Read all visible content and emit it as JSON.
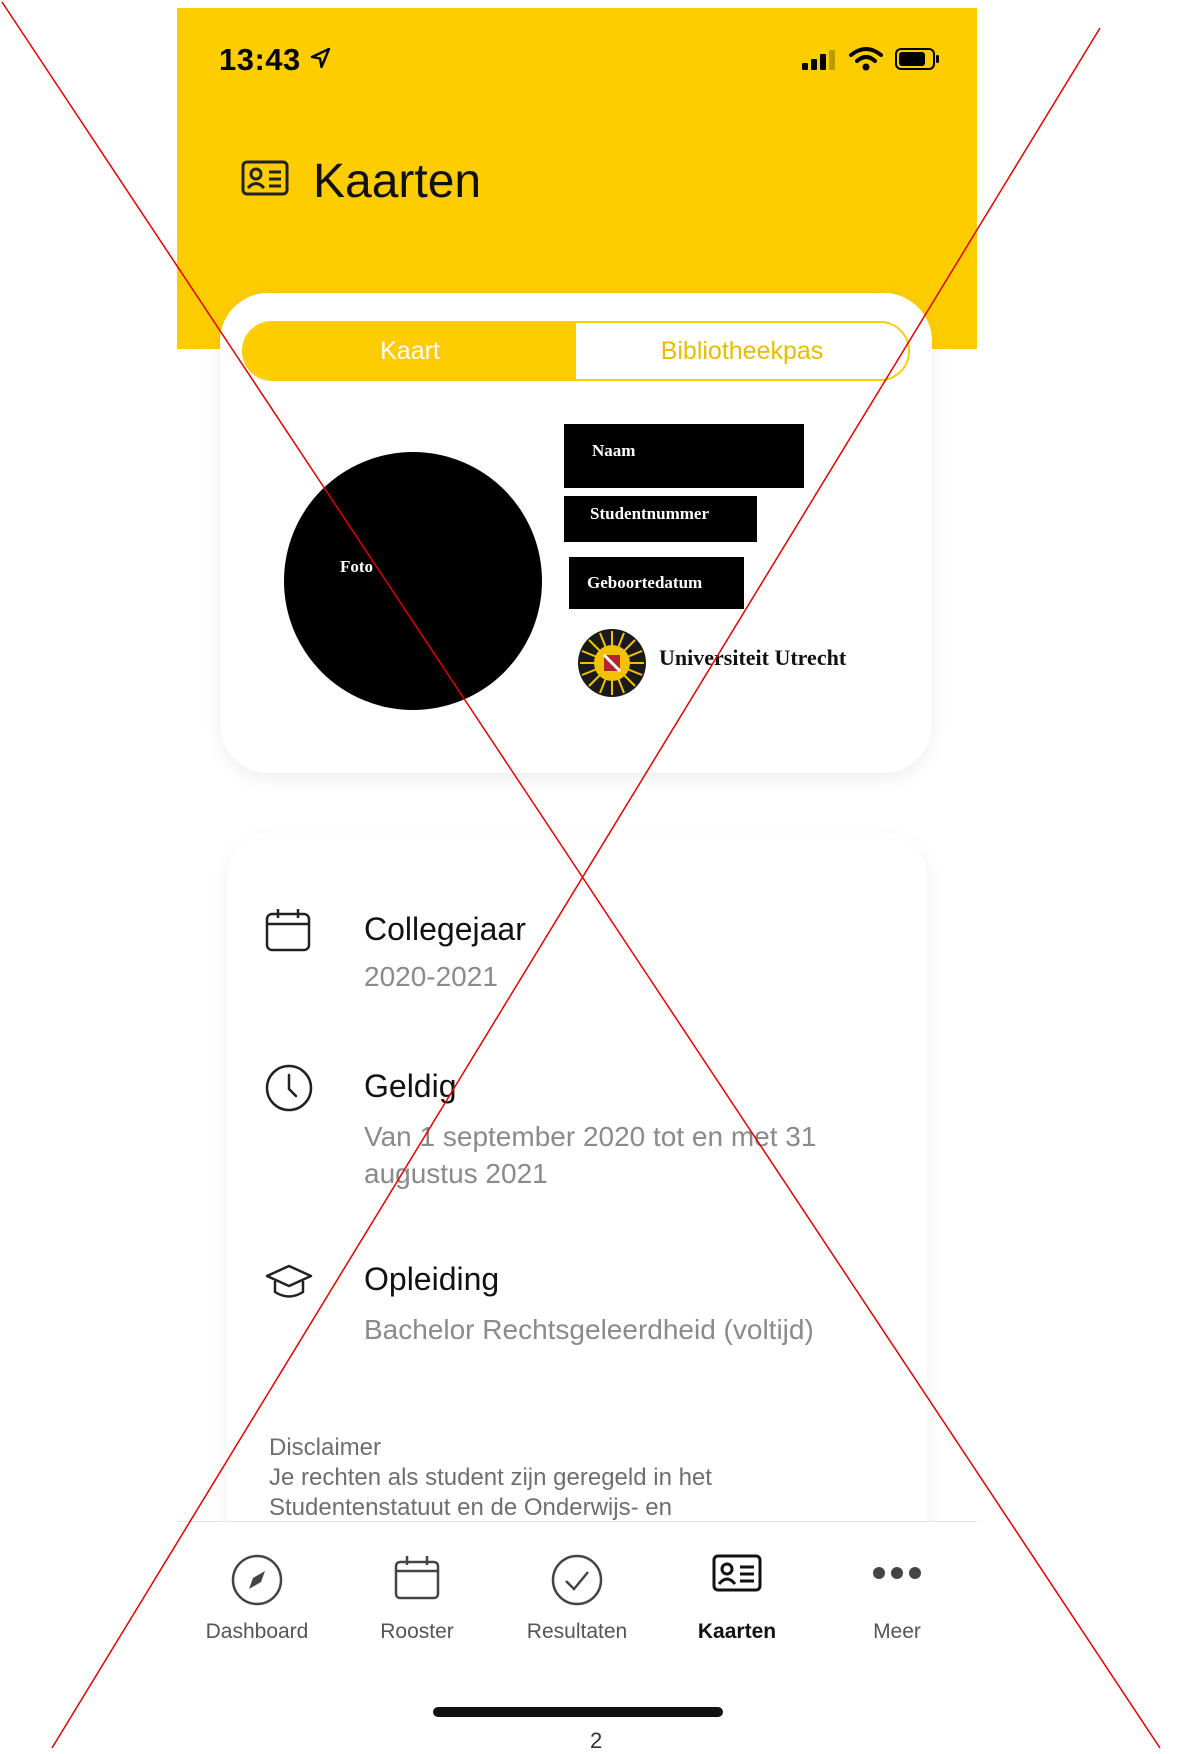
{
  "status_bar": {
    "time": "13:43"
  },
  "header": {
    "title": "Kaarten",
    "title_icon": "id-card-icon"
  },
  "segmented": {
    "left_label": "Kaart",
    "right_label": "Bibliotheekpas",
    "selected": "Kaart"
  },
  "card": {
    "photo_label": "Foto",
    "name_label": "Naam",
    "student_number_label": "Studentnummer",
    "birthdate_label": "Geboortedatum",
    "university": "Universiteit Utrecht"
  },
  "details": [
    {
      "icon": "calendar-icon",
      "title": "Collegejaar",
      "value": "2020-2021"
    },
    {
      "icon": "clock-icon",
      "title": "Geldig",
      "value": "Van 1 september 2020 tot en met 31 augustus 2021"
    },
    {
      "icon": "graduation-cap-icon",
      "title": "Opleiding",
      "value": "Bachelor Rechtsgeleerdheid (voltijd)"
    }
  ],
  "disclaimer": {
    "title": "Disclaimer",
    "text": "Je rechten als student zijn geregeld in het Studentenstatuut en de Onderwijs- en"
  },
  "tabs": [
    {
      "label": "Dashboard",
      "icon": "compass-icon",
      "active": false
    },
    {
      "label": "Rooster",
      "icon": "calendar-icon",
      "active": false
    },
    {
      "label": "Resultaten",
      "icon": "check-circle-icon",
      "active": false
    },
    {
      "label": "Kaarten",
      "icon": "id-card-icon",
      "active": true
    },
    {
      "label": "Meer",
      "icon": "more-icon",
      "active": false
    }
  ],
  "page_mark": "2",
  "colors": {
    "brand_yellow": "#FDCD00",
    "cross_red": "#E00000"
  }
}
